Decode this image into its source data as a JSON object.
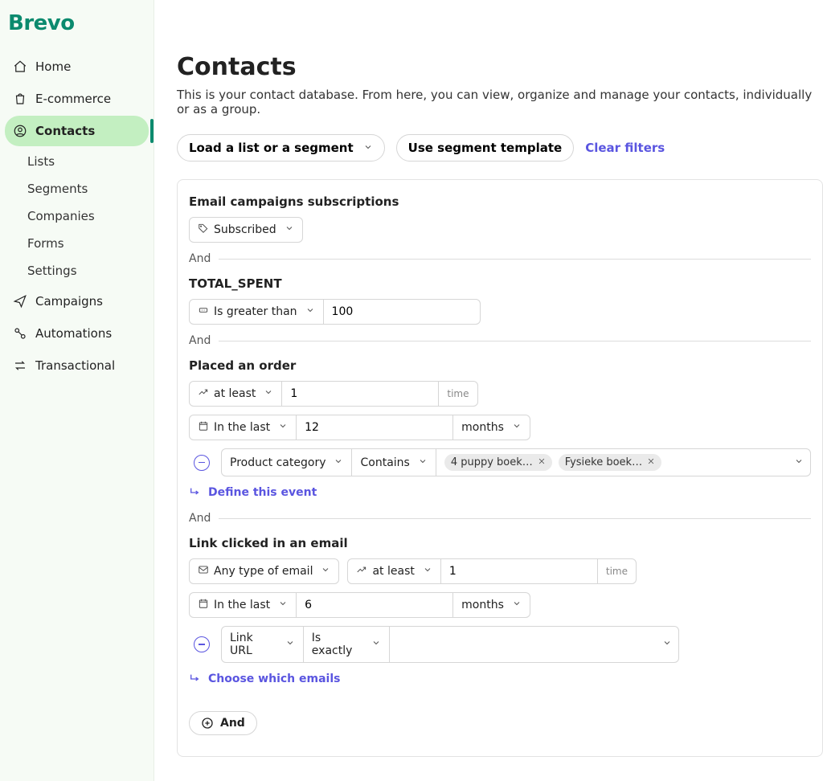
{
  "brand": "Brevo",
  "nav": {
    "home": "Home",
    "ecommerce": "E-commerce",
    "contacts": "Contacts",
    "contacts_sub": {
      "lists": "Lists",
      "segments": "Segments",
      "companies": "Companies",
      "forms": "Forms",
      "settings": "Settings"
    },
    "campaigns": "Campaigns",
    "automations": "Automations",
    "transactional": "Transactional"
  },
  "page": {
    "title": "Contacts",
    "subtitle": "This is your contact database. From here, you can view, organize and manage your contacts, individually or as a group."
  },
  "toolbar": {
    "load": "Load a list or a segment",
    "template": "Use segment template",
    "clear": "Clear filters"
  },
  "filters": {
    "and_label": "And",
    "block1": {
      "title": "Email campaigns subscriptions",
      "value": "Subscribed"
    },
    "block2": {
      "title": "TOTAL_SPENT",
      "operator": "Is greater than",
      "value": "100"
    },
    "block3": {
      "title": "Placed an order",
      "qty_op": "at least",
      "qty_val": "1",
      "qty_unit": "time",
      "range_op": "In the last",
      "range_val": "12",
      "range_unit": "months",
      "sub_field": "Product category",
      "sub_op": "Contains",
      "chips": [
        "4 puppy boek…",
        "Fysieke boek…"
      ],
      "define": "Define this event"
    },
    "block4": {
      "title": "Link clicked in an email",
      "email_type": "Any type of email",
      "qty_op": "at least",
      "qty_val": "1",
      "qty_unit": "time",
      "range_op": "In the last",
      "range_val": "6",
      "range_unit": "months",
      "sub_field": "Link URL",
      "sub_op": "Is exactly",
      "choose": "Choose which emails"
    },
    "add_and": "And"
  }
}
